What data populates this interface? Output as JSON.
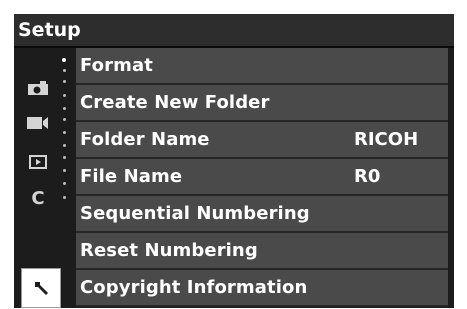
{
  "header": {
    "title": "Setup"
  },
  "sidebar": {
    "icons": [
      {
        "name": "camera-icon"
      },
      {
        "name": "video-camera-icon"
      },
      {
        "name": "playback-icon"
      },
      {
        "name": "custom-c-icon",
        "glyph": "C"
      },
      {
        "name": "wrench-icon",
        "selected": true
      }
    ]
  },
  "menu": {
    "items": [
      {
        "label": "Format",
        "value": ""
      },
      {
        "label": "Create New Folder",
        "value": ""
      },
      {
        "label": "Folder Name",
        "value": "RICOH"
      },
      {
        "label": "File Name",
        "value": "R0"
      },
      {
        "label": "Sequential Numbering",
        "value": ""
      },
      {
        "label": "Reset Numbering",
        "value": ""
      },
      {
        "label": "Copyright Information",
        "value": ""
      }
    ]
  },
  "colors": {
    "background": "#1c1c1c",
    "header": "#2d2d2d",
    "item": "#4a4a4a",
    "text": "#ffffff"
  }
}
